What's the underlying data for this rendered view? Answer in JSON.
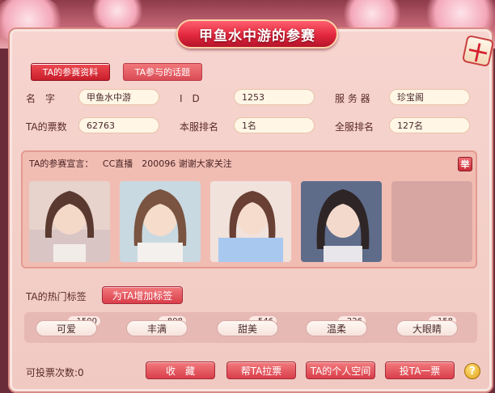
{
  "window": {
    "title": "甲鱼水中游的参赛",
    "close_icon": "十"
  },
  "tabs": [
    {
      "label": "TA的参赛资料",
      "active": true
    },
    {
      "label": "TA参与的话题",
      "active": false
    }
  ],
  "profile": {
    "name_label": "名　字",
    "name_value": "甲鱼水中游",
    "id_label": "I　D",
    "id_value": "1253",
    "server_label": "服 务 器",
    "server_value": "珍宝阁",
    "votes_label": "TA的票数",
    "votes_value": "62763",
    "local_rank_label": "本服排名",
    "local_rank_value": "1名",
    "global_rank_label": "全服排名",
    "global_rank_value": "127名"
  },
  "declaration": {
    "label": "TA的参赛宣言：",
    "text": "CC直播　200096 谢谢大家关注",
    "report_icon": "举"
  },
  "tags_section": {
    "label": "TA的热门标签",
    "add_button": "为TA增加标签",
    "tags": [
      {
        "name": "可爱",
        "count": "1500"
      },
      {
        "name": "丰满",
        "count": "808"
      },
      {
        "name": "甜美",
        "count": "546"
      },
      {
        "name": "温柔",
        "count": "226"
      },
      {
        "name": "大眼睛",
        "count": "158"
      }
    ]
  },
  "footer": {
    "remaining_votes": "可投票次数:0",
    "collect_button": "收　藏",
    "canvass_button": "帮TA拉票",
    "space_button": "TA的个人空间",
    "vote_button": "投TA一票",
    "help_icon": "?"
  },
  "colors": {
    "accent": "#d93e4a",
    "frame": "#f3cfc8",
    "title_banner": "#e2283e"
  }
}
